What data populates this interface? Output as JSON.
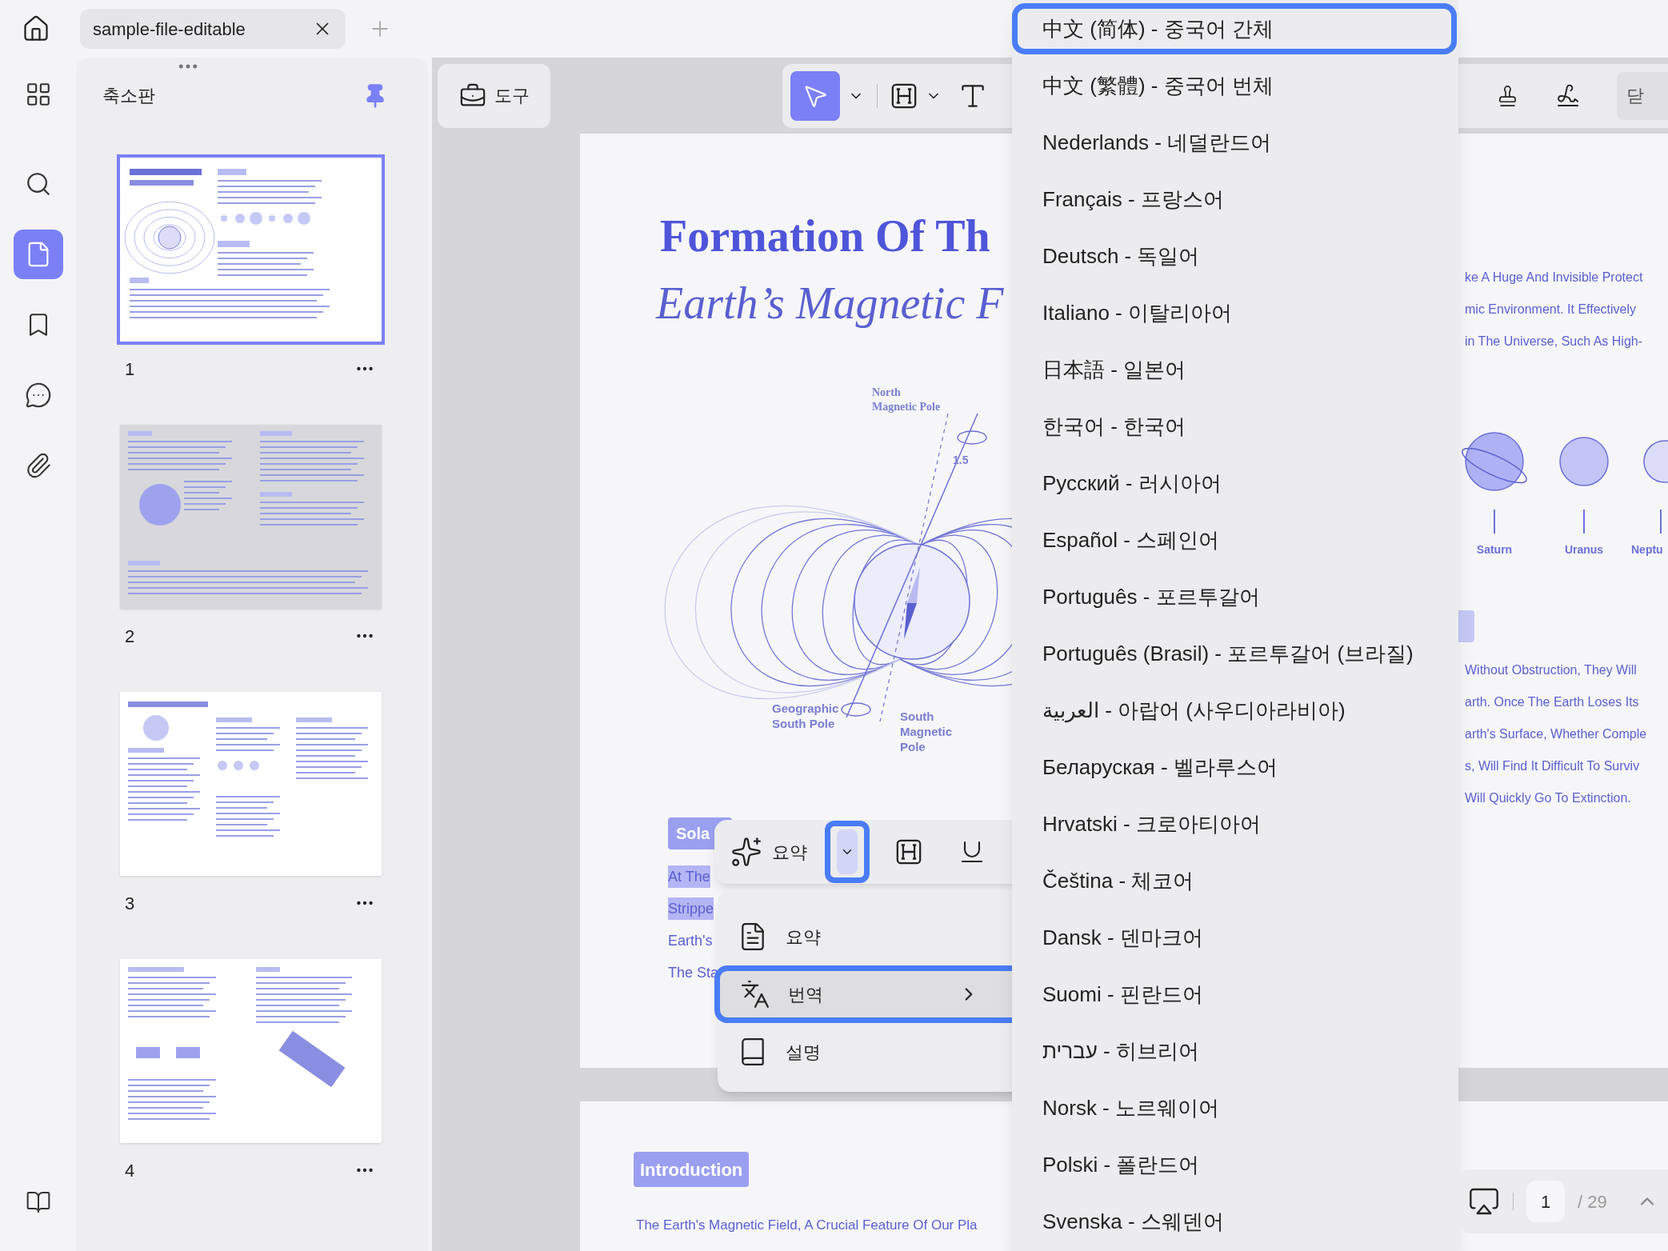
{
  "tabs": [
    {
      "label": "sample-file-editable",
      "selected": true
    }
  ],
  "rail": [
    {
      "selected": false
    },
    {
      "selected": false
    },
    {
      "selected": true
    },
    {
      "selected": false
    },
    {
      "selected": false
    },
    {
      "selected": false
    },
    {
      "selected": false
    }
  ],
  "thumbnails": {
    "title": "축소판",
    "pages": [
      {
        "number": "1",
        "selected": true
      },
      {
        "number": "2",
        "selected": false
      },
      {
        "number": "3",
        "selected": false
      },
      {
        "number": "4",
        "selected": false
      }
    ]
  },
  "toolbar": {
    "tools_label": "도구",
    "cursor_selected": true,
    "close_label": "닫"
  },
  "page": {
    "title": "Formation Of Th",
    "subtitle": "Earth’s Magnetic F",
    "diagram_labels": [
      "North",
      "Magnetic Pole",
      "1.5",
      "Geographic",
      "South Pole",
      "South",
      "Magnetic",
      "Pole"
    ],
    "tag": "Sola",
    "lines": [
      {
        "text": "At The",
        "selected": true
      },
      {
        "text": "Strippe",
        "selected": true
      },
      {
        "text": "Earth's",
        "selected": false
      },
      {
        "text": "The Sta",
        "selected": false
      }
    ],
    "right_lines_top": [
      "ke A Huge And Invisible Protect",
      "mic Environment. It Effectively",
      "in The Universe, Such As High-"
    ],
    "planets": [
      "Saturn",
      "Uranus",
      "Neptu"
    ],
    "right_lines_bottom": [
      "Without Obstruction, They Will",
      "arth. Once The Earth Loses Its",
      "arth's Surface, Whether Comple",
      "s, Will Find It Difficult To Surviv",
      "Will Quickly Go To Extinction."
    ]
  },
  "page2": {
    "tag": "Introduction",
    "line": "The Earth's Magnetic Field, A Crucial Feature Of Our Pla"
  },
  "floating_toolbar": {
    "label": "요약",
    "dropdown_selected": true
  },
  "context_menu": [
    {
      "label": "요약",
      "selected": false,
      "submenu": false
    },
    {
      "label": "번역",
      "selected": true,
      "submenu": true
    },
    {
      "label": "설명",
      "selected": false,
      "submenu": false
    }
  ],
  "languages": [
    {
      "label": "中文 (简体) - 중국어 간체",
      "selected": true
    },
    {
      "label": "中文 (繁體) - 중국어 번체",
      "selected": false
    },
    {
      "label": "Nederlands - 네덜란드어",
      "selected": false
    },
    {
      "label": "Français - 프랑스어",
      "selected": false
    },
    {
      "label": "Deutsch - 독일어",
      "selected": false
    },
    {
      "label": "Italiano - 이탈리아어",
      "selected": false
    },
    {
      "label": "日本語 - 일본어",
      "selected": false
    },
    {
      "label": "한국어 - 한국어",
      "selected": false
    },
    {
      "label": "Русский - 러시아어",
      "selected": false
    },
    {
      "label": "Español - 스페인어",
      "selected": false
    },
    {
      "label": "Português - 포르투갈어",
      "selected": false
    },
    {
      "label": "Português (Brasil) - 포르투갈어 (브라질)",
      "selected": false
    },
    {
      "label": "العربية - 아랍어 (사우디아라비아)",
      "selected": false
    },
    {
      "label": "Беларуская - 벨라루스어",
      "selected": false
    },
    {
      "label": "Hrvatski - 크로아티아어",
      "selected": false
    },
    {
      "label": "Čeština - 체코어",
      "selected": false
    },
    {
      "label": "Dansk - 덴마크어",
      "selected": false
    },
    {
      "label": "Suomi - 핀란드어",
      "selected": false
    },
    {
      "label": "עברית - 히브리어",
      "selected": false
    },
    {
      "label": "Norsk - 노르웨이어",
      "selected": false
    },
    {
      "label": "Polski - 폴란드어",
      "selected": false
    },
    {
      "label": "Svenska - 스웨덴어",
      "selected": false
    }
  ],
  "page_nav": {
    "current": "1",
    "total": "/ 29"
  }
}
